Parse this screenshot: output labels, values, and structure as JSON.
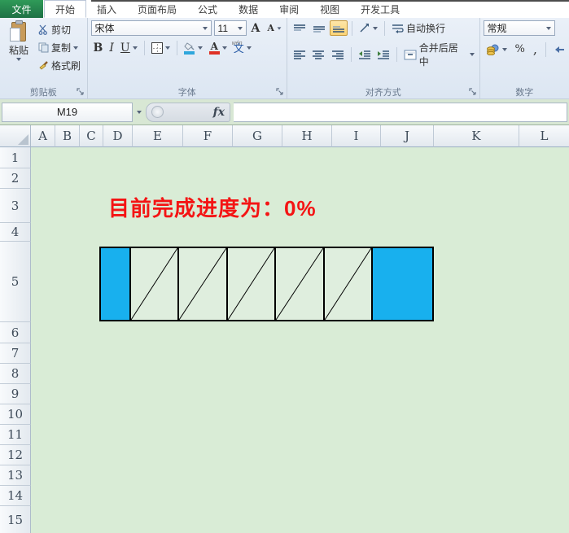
{
  "tabs": {
    "file_label": "文件",
    "items": [
      "开始",
      "插入",
      "页面布局",
      "公式",
      "数据",
      "审阅",
      "视图",
      "开发工具"
    ],
    "active": "开始"
  },
  "ribbon": {
    "clipboard": {
      "label": "剪贴板",
      "paste": "粘贴",
      "cut": "剪切",
      "copy": "复制",
      "format_painter": "格式刷"
    },
    "font": {
      "label": "字体",
      "name": "宋体",
      "size": "11",
      "bold": "B",
      "italic": "I",
      "underline": "U",
      "grow": "A",
      "shrink": "A",
      "font_color_letter": "A",
      "phonetic": "文",
      "phonetic_hint": "wén"
    },
    "alignment": {
      "label": "对齐方式",
      "wrap_text": "自动换行",
      "merge_center": "合并后居中"
    },
    "number": {
      "label": "数字",
      "format": "常规",
      "percent": "%",
      "comma": ","
    }
  },
  "formula_bar": {
    "name_box": "M19",
    "fx_label": "fx"
  },
  "sheet": {
    "columns": [
      "A",
      "B",
      "C",
      "D",
      "E",
      "F",
      "G",
      "H",
      "I",
      "J",
      "K",
      "L"
    ],
    "rows": [
      "1",
      "2",
      "3",
      "4",
      "5",
      "6",
      "7",
      "8",
      "9",
      "10",
      "11",
      "12",
      "13",
      "14",
      "15"
    ],
    "message": "目前完成进度为：0%",
    "progress_bar": {
      "completion_percent": 0,
      "segments": [
        "filled",
        "hatched",
        "hatched",
        "hatched",
        "hatched",
        "hatched",
        "filled"
      ]
    }
  },
  "colors": {
    "file_tab_green": "#1E7145",
    "progress_blue": "#18B0EE",
    "message_red": "#F41414",
    "sheet_green": "#D9ECD6",
    "selected_align_highlight": "#FBD476"
  }
}
